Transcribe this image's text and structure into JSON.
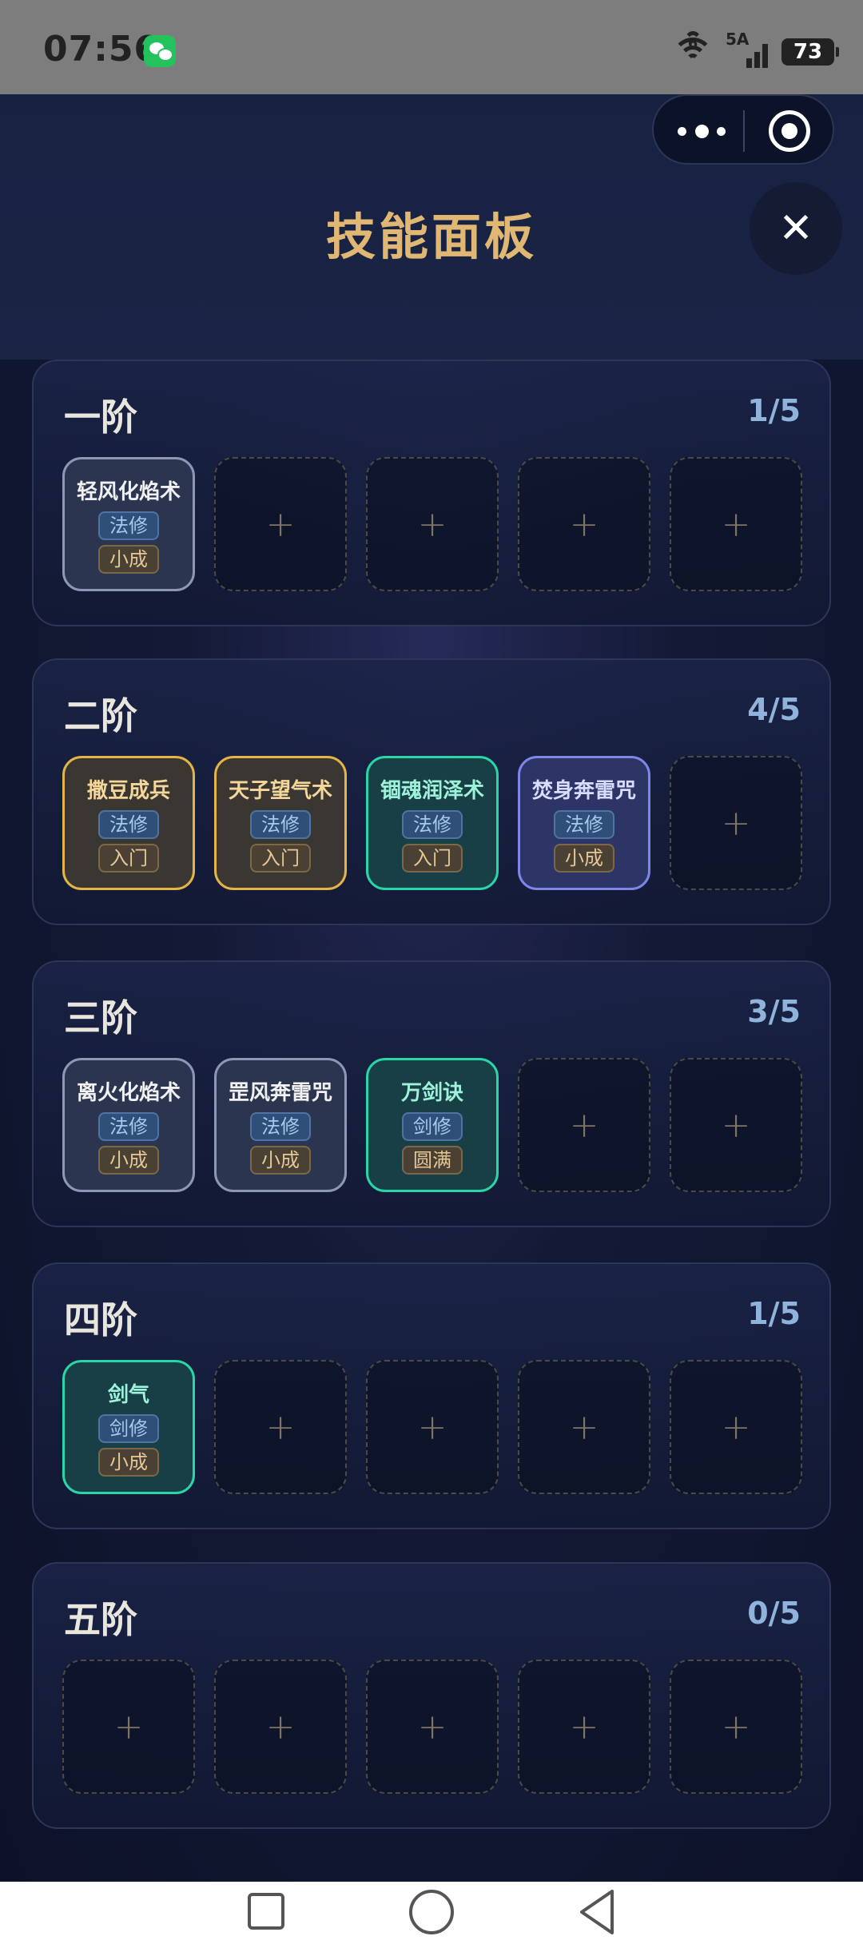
{
  "status_bar": {
    "time": "07:56",
    "wifi_label": "6",
    "signal_label": "5A",
    "battery": "73"
  },
  "header": {
    "title": "技能面板",
    "close_label": "✕"
  },
  "tiers": [
    {
      "name": "一阶",
      "count": "1/5",
      "slots": [
        {
          "name": "轻风化焰术",
          "type": "法修",
          "level": "小成",
          "style": "steel"
        },
        null,
        null,
        null,
        null
      ]
    },
    {
      "name": "二阶",
      "count": "4/5",
      "slots": [
        {
          "name": "撒豆成兵",
          "type": "法修",
          "level": "入门",
          "style": "gold"
        },
        {
          "name": "天子望气术",
          "type": "法修",
          "level": "入门",
          "style": "gold"
        },
        {
          "name": "锢魂润泽术",
          "type": "法修",
          "level": "入门",
          "style": "teal"
        },
        {
          "name": "焚身奔雷咒",
          "type": "法修",
          "level": "小成",
          "style": "violet"
        },
        null
      ]
    },
    {
      "name": "三阶",
      "count": "3/5",
      "slots": [
        {
          "name": "离火化焰术",
          "type": "法修",
          "level": "小成",
          "style": "steel"
        },
        {
          "name": "罡风奔雷咒",
          "type": "法修",
          "level": "小成",
          "style": "steel"
        },
        {
          "name": "万剑诀",
          "type": "剑修",
          "level": "圆满",
          "style": "teal"
        },
        null,
        null
      ]
    },
    {
      "name": "四阶",
      "count": "1/5",
      "slots": [
        {
          "name": "剑气",
          "type": "剑修",
          "level": "小成",
          "style": "teal"
        },
        null,
        null,
        null,
        null
      ]
    },
    {
      "name": "五阶",
      "count": "0/5",
      "slots": [
        null,
        null,
        null,
        null,
        null
      ]
    }
  ],
  "empty_slot_symbol": "+",
  "colors": {
    "title_gold": "#e0b874",
    "count_blue": "#8fb3db",
    "gold_border": "#e2b546",
    "teal_border": "#28d6a8",
    "violet_border": "#7f86e8",
    "steel_border": "#8d98b6"
  },
  "icons": [
    "wechat-icon",
    "wifi-icon",
    "signal-icon",
    "battery-icon",
    "more-icon",
    "target-icon",
    "close-icon",
    "plus-icon",
    "nav-square-icon",
    "nav-circle-icon",
    "nav-back-icon"
  ]
}
